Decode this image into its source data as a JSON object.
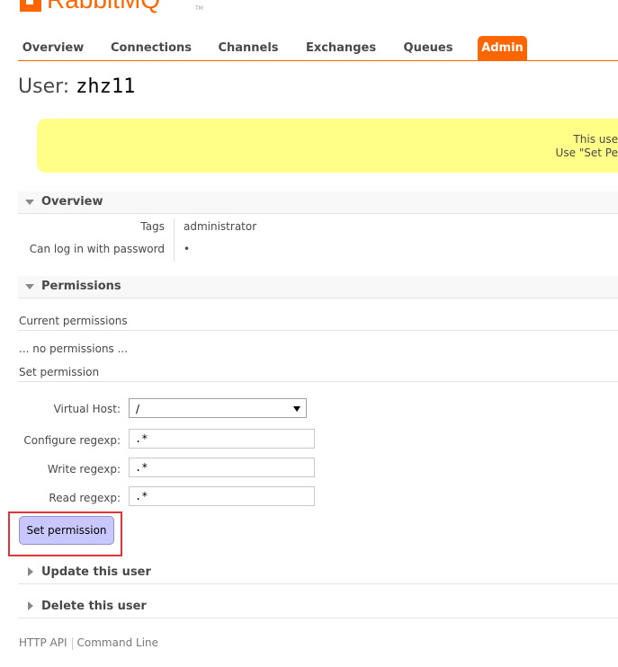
{
  "brand": {
    "logo_text": "RabbitMQ",
    "tm": "TM",
    "color": "#ff6600"
  },
  "nav": {
    "items": [
      {
        "label": "Overview"
      },
      {
        "label": "Connections"
      },
      {
        "label": "Channels"
      },
      {
        "label": "Exchanges"
      },
      {
        "label": "Queues"
      },
      {
        "label": "Admin",
        "active": true
      }
    ]
  },
  "page": {
    "title_prefix": "User:",
    "username": "zhz11"
  },
  "warning": {
    "line1": "This use",
    "line2": "Use \"Set Pe"
  },
  "overview": {
    "heading": "Overview",
    "tags_label": "Tags",
    "tags_value": "administrator",
    "password_label": "Can log in with password",
    "password_value": "•"
  },
  "permissions": {
    "heading": "Permissions",
    "current_heading": "Current permissions",
    "no_permissions": "... no permissions ...",
    "set_heading": "Set permission",
    "vhost_label": "Virtual Host:",
    "vhost_value": "/",
    "configure_label": "Configure regexp:",
    "configure_value": ".*",
    "write_label": "Write regexp:",
    "write_value": ".*",
    "read_label": "Read regexp:",
    "read_value": ".*",
    "submit_label": "Set permission"
  },
  "update": {
    "heading": "Update this user"
  },
  "delete": {
    "heading": "Delete this user"
  },
  "footer": {
    "http_api": "HTTP API",
    "command_line": "Command Line"
  },
  "colors": {
    "accent": "#ff6600",
    "warning_bg": "#ffff88",
    "button_bg": "#c8c8ff",
    "highlight": "#e0353b"
  }
}
